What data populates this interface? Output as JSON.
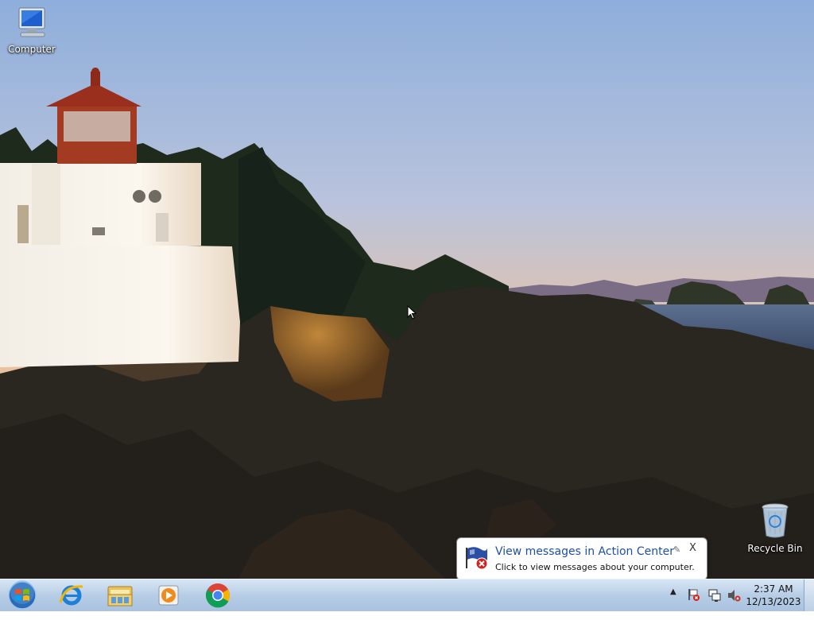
{
  "desktop": {
    "icons": [
      {
        "label": "Computer",
        "icon": "computer-icon"
      },
      {
        "label": "Recycle Bin",
        "icon": "recycle-bin-icon"
      }
    ]
  },
  "notification": {
    "title": "View messages in Action Center",
    "body": "Click to view messages about your computer.",
    "pin_glyph": "✎",
    "close_glyph": "X"
  },
  "taskbar": {
    "pinned": [
      "start-button",
      "internet-explorer",
      "windows-explorer",
      "windows-media-player",
      "google-chrome"
    ],
    "tray_arrow": "▲",
    "clock": {
      "time": "2:37 AM",
      "date": "12/13/2023"
    }
  },
  "colors": {
    "notification_title": "#1e4fa8",
    "taskbar": "#b7cde6"
  }
}
